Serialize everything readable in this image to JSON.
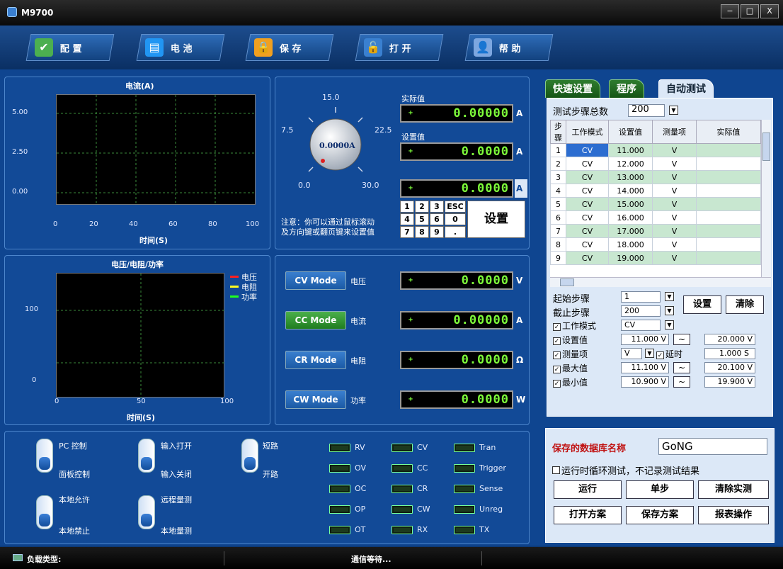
{
  "window": {
    "title": "M9700",
    "controls": [
      "−",
      "□",
      "X"
    ]
  },
  "toolbar": [
    {
      "label": "配 置",
      "icon": "config-icon",
      "color": "#4caf50"
    },
    {
      "label": "电 池",
      "icon": "battery-icon",
      "color": "#2196f3"
    },
    {
      "label": "保 存",
      "icon": "lock-icon",
      "color": "#f0a020"
    },
    {
      "label": "打 开",
      "icon": "unlock-icon",
      "color": "#3a80d0"
    },
    {
      "label": "帮 助",
      "icon": "help-icon",
      "color": "#7da7e0"
    }
  ],
  "current_chart": {
    "title": "电流(A)",
    "xlabel": "时间(S)",
    "yticks": [
      "5.00",
      "2.50",
      "0.00"
    ],
    "xticks": [
      "0",
      "20",
      "40",
      "60",
      "80",
      "100"
    ]
  },
  "vrp_chart": {
    "title": "电压/电阻/功率",
    "xlabel": "时间(S)",
    "yticks": [
      "100",
      "0"
    ],
    "xticks": [
      "0",
      "50",
      "100"
    ],
    "legend": [
      {
        "name": "电压",
        "color": "#ff2020"
      },
      {
        "name": "电阻",
        "color": "#ffff20"
      },
      {
        "name": "功率",
        "color": "#20ff20"
      }
    ]
  },
  "knob": {
    "value": "0.0000A",
    "labels": [
      "15.0",
      "7.5",
      "22.5",
      "0.0",
      "30.0"
    ]
  },
  "readout": {
    "actual_label": "实际值",
    "actual_value": "0.00000",
    "actual_unit": "A",
    "set_label": "设置值",
    "set_value": "0.0000",
    "set_unit": "A",
    "input_value": "0.0000",
    "input_unit": "A",
    "note1": "注意：你可以通过鼠标滚动",
    "note2": "及方向键或翻页键来设置值",
    "set_button": "设置"
  },
  "keypad": [
    "1",
    "2",
    "3",
    "ESC",
    "4",
    "5",
    "6",
    "0",
    "7",
    "8",
    "9",
    "."
  ],
  "modes": [
    {
      "button": "CV Mode",
      "label": "电压",
      "value": "0.0000",
      "unit": "V",
      "active": false
    },
    {
      "button": "CC Mode",
      "label": "电流",
      "value": "0.00000",
      "unit": "A",
      "active": true
    },
    {
      "button": "CR Mode",
      "label": "电阻",
      "value": "0.0000",
      "unit": "Ω",
      "active": false
    },
    {
      "button": "CW Mode",
      "label": "功率",
      "value": "0.0000",
      "unit": "W",
      "active": false
    }
  ],
  "switches": [
    {
      "top": "PC 控制",
      "bottom": "面板控制"
    },
    {
      "top": "输入打开",
      "bottom": "输入关闭"
    },
    {
      "top": "短路",
      "bottom": "开路"
    },
    {
      "top": "本地允许",
      "bottom": "本地禁止"
    },
    {
      "top": "远程量测",
      "bottom": "本地量测"
    }
  ],
  "leds": [
    [
      "RV",
      "CV",
      "Tran"
    ],
    [
      "OV",
      "CC",
      "Trigger"
    ],
    [
      "OC",
      "CR",
      "Sense"
    ],
    [
      "OP",
      "CW",
      "Unreg"
    ],
    [
      "OT",
      "RX",
      "TX"
    ]
  ],
  "tabs": [
    "快速设置",
    "程序",
    "自动测试"
  ],
  "autotest": {
    "total_label": "测试步骤总数",
    "total_value": "200",
    "headers": [
      "步骤",
      "工作模式",
      "设置值",
      "测量项",
      "实际值"
    ],
    "rows": [
      [
        "1",
        "CV",
        "11.000",
        "V",
        ""
      ],
      [
        "2",
        "CV",
        "12.000",
        "V",
        ""
      ],
      [
        "3",
        "CV",
        "13.000",
        "V",
        ""
      ],
      [
        "4",
        "CV",
        "14.000",
        "V",
        ""
      ],
      [
        "5",
        "CV",
        "15.000",
        "V",
        ""
      ],
      [
        "6",
        "CV",
        "16.000",
        "V",
        ""
      ],
      [
        "7",
        "CV",
        "17.000",
        "V",
        ""
      ],
      [
        "8",
        "CV",
        "18.000",
        "V",
        ""
      ],
      [
        "9",
        "CV",
        "19.000",
        "V",
        ""
      ]
    ],
    "start_label": "起始步骤",
    "start_value": "1",
    "end_label": "截止步骤",
    "end_value": "200",
    "set_button": "设置",
    "clear_button": "清除",
    "mode_label": "工作模式",
    "mode_value": "CV",
    "setval_label": "设置值",
    "setval_from": "11.000 V",
    "setval_to": "20.000 V",
    "meas_label": "测量项",
    "meas_value": "V",
    "delay_label": "延时",
    "delay_value": "1.000 S",
    "max_label": "最大值",
    "max_from": "11.100 V",
    "max_to": "20.100 V",
    "min_label": "最小值",
    "min_from": "10.900 V",
    "min_to": "19.900 V",
    "tilde": "~"
  },
  "save": {
    "db_label": "保存的数据库名称",
    "db_value": "GoNG",
    "loop_label": "运行时循环测试，不记录测试结果",
    "run": "运行",
    "step": "单步",
    "clear": "清除实测",
    "open_plan": "打开方案",
    "save_plan": "保存方案",
    "report": "报表操作"
  },
  "status": {
    "load_type": "负载类型:",
    "comm": "通信等待..."
  }
}
